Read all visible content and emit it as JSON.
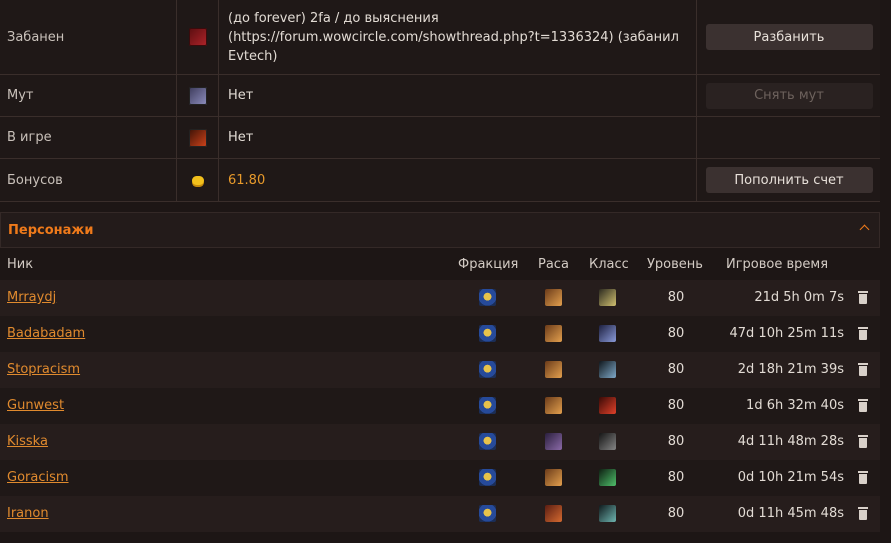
{
  "account_info": [
    {
      "label": "Забанен",
      "icon": "ban-icon",
      "value": "(до forever) 2fa / до выяснения (https://forum.wowcircle.com/showthread.php?t=1336324) (забанил Evtech)",
      "action": "Разбанить",
      "action_enabled": true
    },
    {
      "label": "Мут",
      "icon": "mute-icon",
      "value": "Нет",
      "action": "Снять мут",
      "action_enabled": false
    },
    {
      "label": "В игре",
      "icon": "in-game-icon",
      "value": "Нет",
      "action": "",
      "action_enabled": false
    },
    {
      "label": "Бонусов",
      "icon": "coin-icon",
      "value": "61.80",
      "action": "Пополнить счет",
      "action_enabled": true
    }
  ],
  "characters": {
    "title": "Персонажи",
    "headers": {
      "nick": "Ник",
      "faction": "Фракция",
      "race": "Раса",
      "class": "Класс",
      "level": "Уровень",
      "playtime": "Игровое время"
    },
    "rows": [
      {
        "nick": "Mrraydj",
        "faction": "alliance-icon",
        "race": "human-race-icon",
        "class": "class-icon-a",
        "level": "80",
        "playtime": "21d 5h 0m 7s"
      },
      {
        "nick": "Badabadam",
        "faction": "alliance-icon",
        "race": "human-race-icon",
        "class": "class-icon-b",
        "level": "80",
        "playtime": "47d 10h 25m 11s"
      },
      {
        "nick": "Stopracism",
        "faction": "alliance-icon",
        "race": "human-race-icon",
        "class": "class-icon-c",
        "level": "80",
        "playtime": "2d 18h 21m 39s"
      },
      {
        "nick": "Gunwest",
        "faction": "alliance-icon",
        "race": "human-race-icon",
        "class": "class-icon-d",
        "level": "80",
        "playtime": "1d 6h 32m 40s"
      },
      {
        "nick": "Kisska",
        "faction": "alliance-icon",
        "race": "night-elf-race-icon",
        "class": "class-icon-e",
        "level": "80",
        "playtime": "4d 11h 48m 28s"
      },
      {
        "nick": "Goracism",
        "faction": "alliance-icon",
        "race": "human-race-icon",
        "class": "class-icon-f",
        "level": "80",
        "playtime": "0d 10h 21m 54s"
      },
      {
        "nick": "Iranon",
        "faction": "alliance-icon",
        "race": "human-race-icon",
        "class": "class-icon-g",
        "level": "80",
        "playtime": "0d 11h 45m 48s"
      }
    ]
  }
}
